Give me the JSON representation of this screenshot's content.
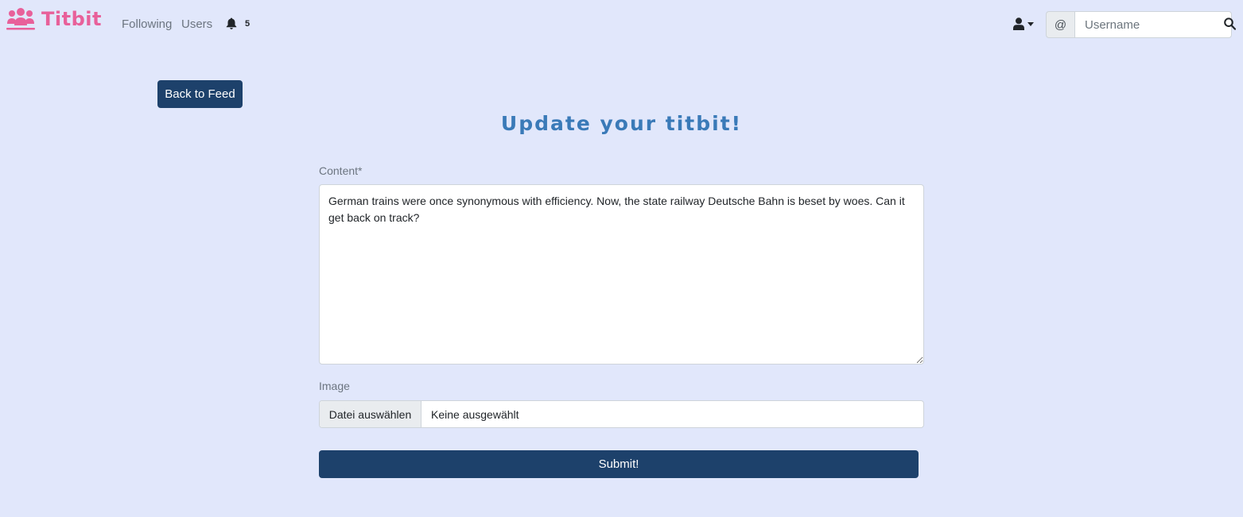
{
  "brand": {
    "name": "Titbit",
    "icon": "users-icon",
    "color": "#e8609a"
  },
  "nav": {
    "following": "Following",
    "users": "Users",
    "notification_count": "5"
  },
  "search": {
    "prefix": "@",
    "placeholder": "Username"
  },
  "page": {
    "back_label": "Back to Feed",
    "title": "Update your titbit!",
    "content_label": "Content*",
    "content_value": "German trains were once synonymous with efficiency. Now, the state railway Deutsche Bahn is beset by woes. Can it get back on track?",
    "image_label": "Image",
    "file_button": "Datei auswählen",
    "file_status": "Keine ausgewählt",
    "submit_label": "Submit!"
  },
  "colors": {
    "background": "#e1e7fb",
    "primary_button": "#1d416b",
    "title": "#3a7ab8",
    "brand": "#e8609a"
  }
}
